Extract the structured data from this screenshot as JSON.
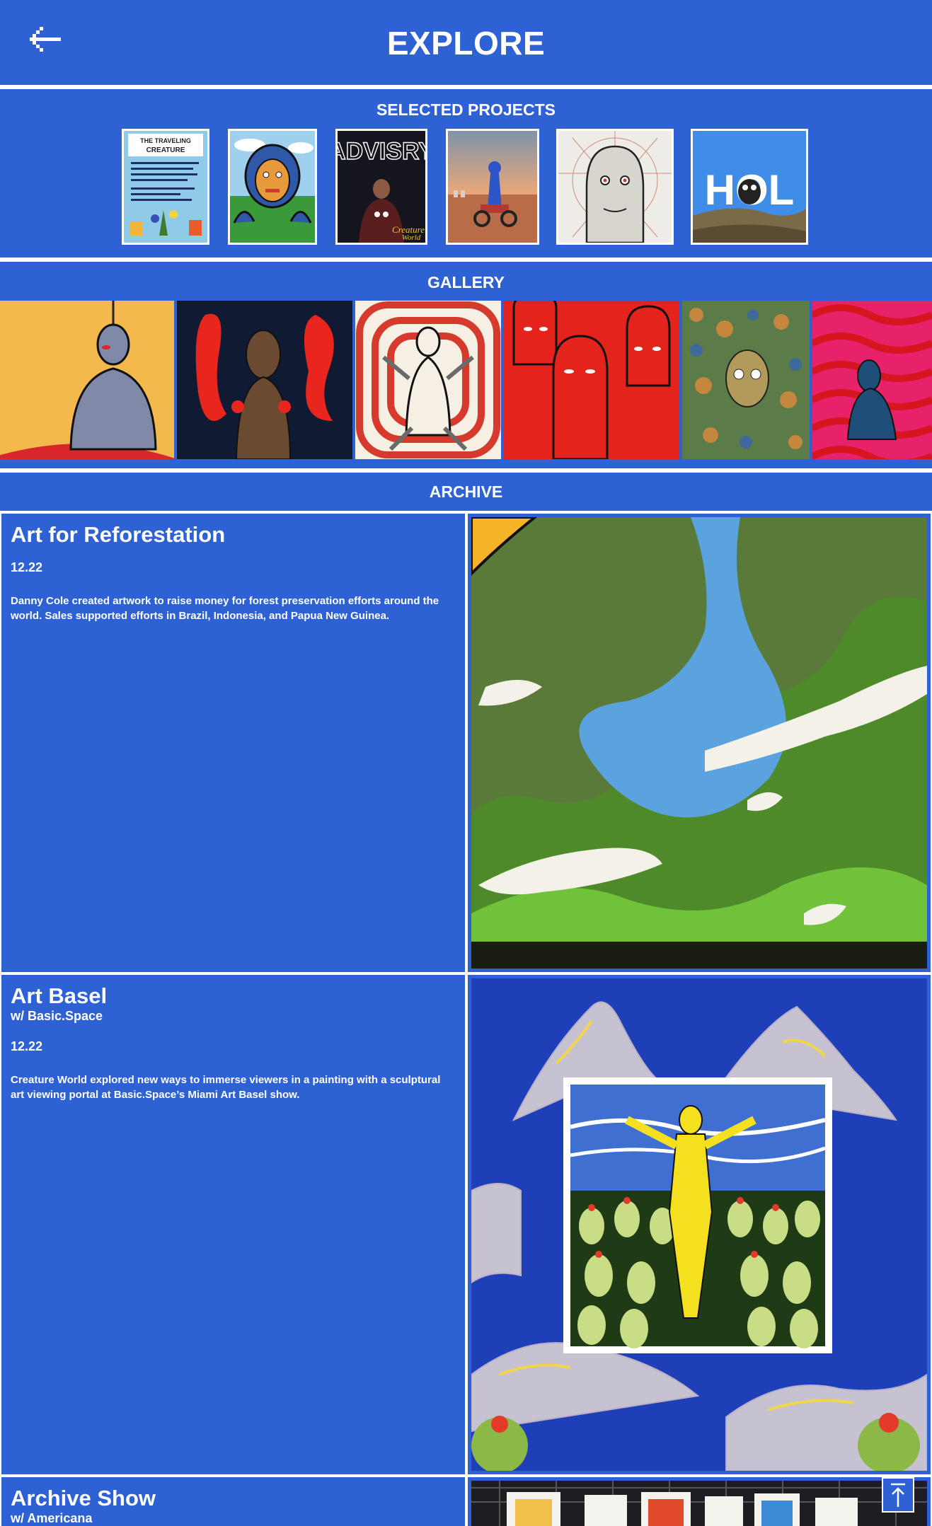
{
  "header": {
    "title": "EXPLORE",
    "back_icon": "arrow-left-icon"
  },
  "selected_projects": {
    "title": "SELECTED PROJECTS",
    "items": [
      {
        "label": "THE TRAVELING CREATURE"
      },
      {
        "label": ""
      },
      {
        "label": "ADVISRY"
      },
      {
        "label": ""
      },
      {
        "label": ""
      },
      {
        "label": "HOL"
      }
    ]
  },
  "gallery": {
    "title": "GALLERY"
  },
  "archive": {
    "title": "ARCHIVE",
    "entries": [
      {
        "title": "Art for Reforestation",
        "subtitle": "",
        "date": "12.22",
        "description": "Danny Cole created artwork to raise money for forest preservation efforts around the world. Sales supported efforts in Brazil, Indonesia, and Papua New Guinea."
      },
      {
        "title": "Art Basel",
        "subtitle": "w/ Basic.Space",
        "date": "12.22",
        "description": "Creature World explored new ways to immerse viewers in a painting with a sculptural art viewing portal at Basic.Space’s Miami Art Basel show."
      },
      {
        "title": "Archive Show",
        "subtitle": "w/ Americana",
        "date": "",
        "description": ""
      }
    ]
  },
  "scroll_top_icon": "arrow-up-to-top-icon",
  "colors": {
    "brand_blue": "#2e62d4",
    "white": "#ffffff"
  }
}
